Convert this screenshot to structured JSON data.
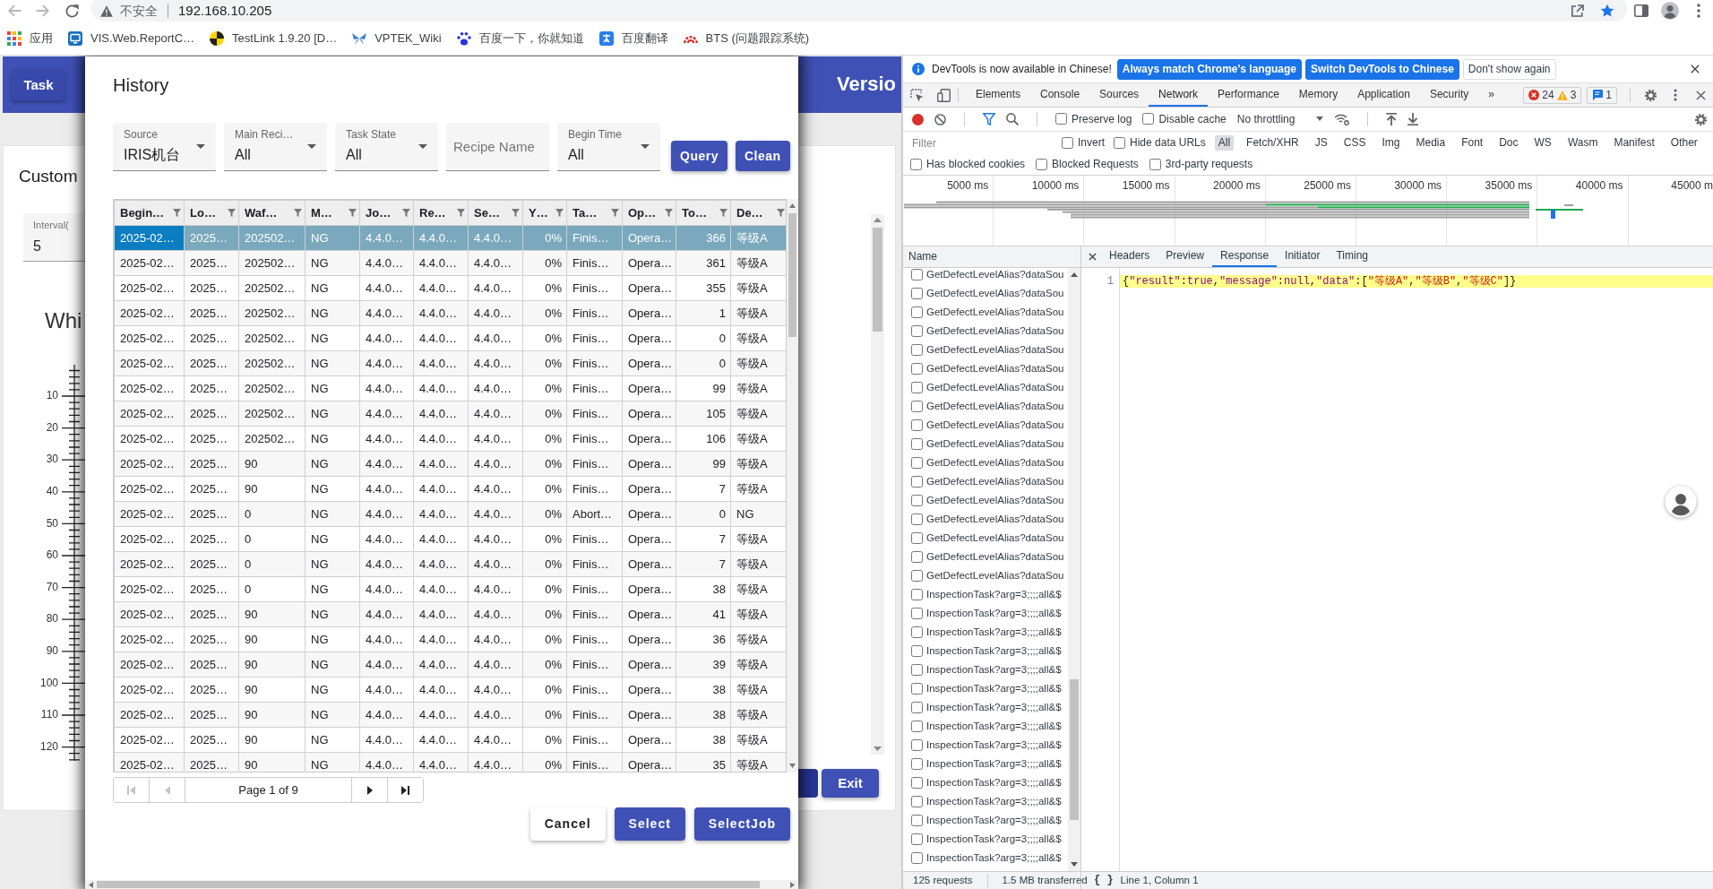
{
  "browser": {
    "address": {
      "security_label": "不安全",
      "url": "192.168.10.205",
      "bookmarked": true
    },
    "bookmarks": [
      {
        "label": "应用",
        "kind": "apps"
      },
      {
        "label": "VIS.Web.ReportC…",
        "kind": "monitor"
      },
      {
        "label": "TestLink 1.9.20 [D…",
        "kind": "testlink"
      },
      {
        "label": "VPTEK_Wiki",
        "kind": "wiki"
      },
      {
        "label": "百度一下，你就知道",
        "kind": "paw"
      },
      {
        "label": "百度翻译",
        "kind": "translate"
      },
      {
        "label": "BTS (问题跟踪系统)",
        "kind": "bts"
      }
    ]
  },
  "app_page": {
    "task_button": "Task",
    "version_title": "Versio",
    "card_title": "Custom",
    "interval": {
      "label": "Interval(",
      "value": "5"
    },
    "heading": "Whi",
    "ruler_labels": [
      "10",
      "20",
      "30",
      "40",
      "50",
      "60",
      "70",
      "80",
      "90",
      "100",
      "110",
      "120"
    ],
    "exit_button": "Exit"
  },
  "history_dialog": {
    "title": "History",
    "filters": [
      {
        "kind": "select",
        "label": "Source",
        "value": "IRIS机台"
      },
      {
        "kind": "select",
        "label": "Main Reci…",
        "value": "All"
      },
      {
        "kind": "select",
        "label": "Task State",
        "value": "All"
      },
      {
        "kind": "text",
        "placeholder": "Recipe Name"
      },
      {
        "kind": "select",
        "label": "Begin Time",
        "value": "All"
      }
    ],
    "actions": [
      "Query",
      "Clean"
    ],
    "table": {
      "columns": [
        {
          "label": "Begin…",
          "kind": "text"
        },
        {
          "label": "Lo…",
          "kind": "text"
        },
        {
          "label": "Waf…",
          "kind": "text"
        },
        {
          "label": "M…",
          "kind": "text"
        },
        {
          "label": "Jo…",
          "kind": "text"
        },
        {
          "label": "Re…",
          "kind": "text"
        },
        {
          "label": "Se…",
          "kind": "text"
        },
        {
          "label": "Y…",
          "kind": "number"
        },
        {
          "label": "Ta…",
          "kind": "text"
        },
        {
          "label": "Op…",
          "kind": "text"
        },
        {
          "label": "To…",
          "kind": "number"
        },
        {
          "label": "De…",
          "kind": "text"
        }
      ],
      "rows": [
        {
          "selected": true,
          "focused": true,
          "cells": [
            "2025-02…",
            "2025…",
            "202502…",
            "NG",
            "4.4.0…",
            "4.4.0…",
            "4.4.0…",
            "0%",
            "Finis…",
            "Opera…",
            "366",
            "等级A"
          ]
        },
        {
          "selected": false,
          "focused": false,
          "cells": [
            "2025-02…",
            "2025…",
            "202502…",
            "NG",
            "4.4.0…",
            "4.4.0…",
            "4.4.0…",
            "0%",
            "Finis…",
            "Opera…",
            "361",
            "等级A"
          ]
        },
        {
          "selected": false,
          "focused": false,
          "cells": [
            "2025-02…",
            "2025…",
            "202502…",
            "NG",
            "4.4.0…",
            "4.4.0…",
            "4.4.0…",
            "0%",
            "Finis…",
            "Opera…",
            "355",
            "等级A"
          ]
        },
        {
          "selected": false,
          "focused": false,
          "cells": [
            "2025-02…",
            "2025…",
            "202502…",
            "NG",
            "4.4.0…",
            "4.4.0…",
            "4.4.0…",
            "0%",
            "Finis…",
            "Opera…",
            "1",
            "等级A"
          ]
        },
        {
          "selected": false,
          "focused": false,
          "cells": [
            "2025-02…",
            "2025…",
            "202502…",
            "NG",
            "4.4.0…",
            "4.4.0…",
            "4.4.0…",
            "0%",
            "Finis…",
            "Opera…",
            "0",
            "等级A"
          ]
        },
        {
          "selected": false,
          "focused": false,
          "cells": [
            "2025-02…",
            "2025…",
            "202502…",
            "NG",
            "4.4.0…",
            "4.4.0…",
            "4.4.0…",
            "0%",
            "Finis…",
            "Opera…",
            "0",
            "等级A"
          ]
        },
        {
          "selected": false,
          "focused": false,
          "cells": [
            "2025-02…",
            "2025…",
            "202502…",
            "NG",
            "4.4.0…",
            "4.4.0…",
            "4.4.0…",
            "0%",
            "Finis…",
            "Opera…",
            "99",
            "等级A"
          ]
        },
        {
          "selected": false,
          "focused": false,
          "cells": [
            "2025-02…",
            "2025…",
            "202502…",
            "NG",
            "4.4.0…",
            "4.4.0…",
            "4.4.0…",
            "0%",
            "Finis…",
            "Opera…",
            "105",
            "等级A"
          ]
        },
        {
          "selected": false,
          "focused": false,
          "cells": [
            "2025-02…",
            "2025…",
            "202502…",
            "NG",
            "4.4.0…",
            "4.4.0…",
            "4.4.0…",
            "0%",
            "Finis…",
            "Opera…",
            "106",
            "等级A"
          ]
        },
        {
          "selected": false,
          "focused": false,
          "cells": [
            "2025-02…",
            "2025…",
            "90",
            "NG",
            "4.4.0…",
            "4.4.0…",
            "4.4.0…",
            "0%",
            "Finis…",
            "Opera…",
            "99",
            "等级A"
          ]
        },
        {
          "selected": false,
          "focused": false,
          "cells": [
            "2025-02…",
            "2025…",
            "90",
            "NG",
            "4.4.0…",
            "4.4.0…",
            "4.4.0…",
            "0%",
            "Finis…",
            "Opera…",
            "7",
            "等级A"
          ]
        },
        {
          "selected": false,
          "focused": false,
          "cells": [
            "2025-02…",
            "2025…",
            "0",
            "NG",
            "4.4.0…",
            "4.4.0…",
            "4.4.0…",
            "0%",
            "Abort…",
            "Opera…",
            "0",
            "NG"
          ]
        },
        {
          "selected": false,
          "focused": false,
          "cells": [
            "2025-02…",
            "2025…",
            "0",
            "NG",
            "4.4.0…",
            "4.4.0…",
            "4.4.0…",
            "0%",
            "Finis…",
            "Opera…",
            "7",
            "等级A"
          ]
        },
        {
          "selected": false,
          "focused": false,
          "cells": [
            "2025-02…",
            "2025…",
            "0",
            "NG",
            "4.4.0…",
            "4.4.0…",
            "4.4.0…",
            "0%",
            "Finis…",
            "Opera…",
            "7",
            "等级A"
          ]
        },
        {
          "selected": false,
          "focused": false,
          "cells": [
            "2025-02…",
            "2025…",
            "0",
            "NG",
            "4.4.0…",
            "4.4.0…",
            "4.4.0…",
            "0%",
            "Finis…",
            "Opera…",
            "38",
            "等级A"
          ]
        },
        {
          "selected": false,
          "focused": false,
          "cells": [
            "2025-02…",
            "2025…",
            "90",
            "NG",
            "4.4.0…",
            "4.4.0…",
            "4.4.0…",
            "0%",
            "Finis…",
            "Opera…",
            "41",
            "等级A"
          ]
        },
        {
          "selected": false,
          "focused": false,
          "cells": [
            "2025-02…",
            "2025…",
            "90",
            "NG",
            "4.4.0…",
            "4.4.0…",
            "4.4.0…",
            "0%",
            "Finis…",
            "Opera…",
            "36",
            "等级A"
          ]
        },
        {
          "selected": false,
          "focused": false,
          "cells": [
            "2025-02…",
            "2025…",
            "90",
            "NG",
            "4.4.0…",
            "4.4.0…",
            "4.4.0…",
            "0%",
            "Finis…",
            "Opera…",
            "39",
            "等级A"
          ]
        },
        {
          "selected": false,
          "focused": false,
          "cells": [
            "2025-02…",
            "2025…",
            "90",
            "NG",
            "4.4.0…",
            "4.4.0…",
            "4.4.0…",
            "0%",
            "Finis…",
            "Opera…",
            "38",
            "等级A"
          ]
        },
        {
          "selected": false,
          "focused": false,
          "cells": [
            "2025-02…",
            "2025…",
            "90",
            "NG",
            "4.4.0…",
            "4.4.0…",
            "4.4.0…",
            "0%",
            "Finis…",
            "Opera…",
            "38",
            "等级A"
          ]
        },
        {
          "selected": false,
          "focused": false,
          "cells": [
            "2025-02…",
            "2025…",
            "90",
            "NG",
            "4.4.0…",
            "4.4.0…",
            "4.4.0…",
            "0%",
            "Finis…",
            "Opera…",
            "38",
            "等级A"
          ]
        },
        {
          "selected": false,
          "focused": false,
          "cells": [
            "2025-02…",
            "2025…",
            "90",
            "NG",
            "4.4.0…",
            "4.4.0…",
            "4.4.0…",
            "0%",
            "Finis…",
            "Opera…",
            "35",
            "等级A"
          ]
        }
      ]
    },
    "pagination": {
      "label": "Page 1 of 9",
      "buttons": [
        {
          "kind": "first",
          "disabled": true
        },
        {
          "kind": "prev",
          "disabled": true
        },
        {
          "kind": "next",
          "disabled": false
        },
        {
          "kind": "last",
          "disabled": false
        }
      ]
    },
    "buttons": [
      {
        "label": "Cancel",
        "kind": "secondary"
      },
      {
        "label": "Select",
        "kind": "primary"
      },
      {
        "label": "SelectJob",
        "kind": "primary"
      }
    ]
  },
  "devtools": {
    "infobar": {
      "message": "DevTools is now available in Chinese!",
      "buttons": [
        {
          "label": "Always match Chrome's language",
          "kind": "primary"
        },
        {
          "label": "Switch DevTools to Chinese",
          "kind": "primary"
        },
        {
          "label": "Don't show again",
          "kind": "plain"
        }
      ]
    },
    "tabs": [
      {
        "label": "Elements",
        "selected": false
      },
      {
        "label": "Console",
        "selected": false
      },
      {
        "label": "Sources",
        "selected": false
      },
      {
        "label": "Network",
        "selected": true
      },
      {
        "label": "Performance",
        "selected": false
      },
      {
        "label": "Memory",
        "selected": false
      },
      {
        "label": "Application",
        "selected": false
      },
      {
        "label": "Security",
        "selected": false
      }
    ],
    "more_tabs": "»",
    "error_count": "24",
    "warning_count": "3",
    "message_count": "1",
    "toolbar": {
      "recording": true,
      "options": [
        {
          "label": "Preserve log",
          "checked": false
        },
        {
          "label": "Disable cache",
          "checked": false
        }
      ],
      "throttling": "No throttling"
    },
    "filter": {
      "placeholder": "Filter",
      "options": [
        {
          "label": "Invert",
          "checked": false
        },
        {
          "label": "Hide data URLs",
          "checked": false
        }
      ],
      "types": [
        {
          "label": "All",
          "selected": true
        },
        {
          "label": "Fetch/XHR",
          "selected": false
        },
        {
          "label": "JS",
          "selected": false
        },
        {
          "label": "CSS",
          "selected": false
        },
        {
          "label": "Img",
          "selected": false
        },
        {
          "label": "Media",
          "selected": false
        },
        {
          "label": "Font",
          "selected": false
        },
        {
          "label": "Doc",
          "selected": false
        },
        {
          "label": "WS",
          "selected": false
        },
        {
          "label": "Wasm",
          "selected": false
        },
        {
          "label": "Manifest",
          "selected": false
        },
        {
          "label": "Other",
          "selected": false
        }
      ]
    },
    "more_options": [
      {
        "label": "Has blocked cookies",
        "checked": false
      },
      {
        "label": "Blocked Requests",
        "checked": false
      },
      {
        "label": "3rd-party requests",
        "checked": false
      }
    ],
    "overview_ticks": [
      "5000 ms",
      "10000 ms",
      "15000 ms",
      "20000 ms",
      "25000 ms",
      "30000 ms",
      "35000 ms",
      "40000 ms",
      "45000 m"
    ],
    "requests": {
      "header": "Name",
      "items": [
        {
          "name": "GetDefectLevelAlias?dataSou",
          "checked": false
        },
        {
          "name": "GetDefectLevelAlias?dataSou",
          "checked": false
        },
        {
          "name": "GetDefectLevelAlias?dataSou",
          "checked": false
        },
        {
          "name": "GetDefectLevelAlias?dataSou",
          "checked": false
        },
        {
          "name": "GetDefectLevelAlias?dataSou",
          "checked": false
        },
        {
          "name": "GetDefectLevelAlias?dataSou",
          "checked": false
        },
        {
          "name": "GetDefectLevelAlias?dataSou",
          "checked": false
        },
        {
          "name": "GetDefectLevelAlias?dataSou",
          "checked": false
        },
        {
          "name": "GetDefectLevelAlias?dataSou",
          "checked": false
        },
        {
          "name": "GetDefectLevelAlias?dataSou",
          "checked": false
        },
        {
          "name": "GetDefectLevelAlias?dataSou",
          "checked": false
        },
        {
          "name": "GetDefectLevelAlias?dataSou",
          "checked": false
        },
        {
          "name": "GetDefectLevelAlias?dataSou",
          "checked": false
        },
        {
          "name": "GetDefectLevelAlias?dataSou",
          "checked": false
        },
        {
          "name": "GetDefectLevelAlias?dataSou",
          "checked": false
        },
        {
          "name": "GetDefectLevelAlias?dataSou",
          "checked": false
        },
        {
          "name": "GetDefectLevelAlias?dataSou",
          "checked": false
        },
        {
          "name": "InspectionTask?arg=3;;;;all&$",
          "checked": false
        },
        {
          "name": "InspectionTask?arg=3;;;;all&$",
          "checked": false
        },
        {
          "name": "InspectionTask?arg=3;;;;all&$",
          "checked": false
        },
        {
          "name": "InspectionTask?arg=3;;;;all&$",
          "checked": false
        },
        {
          "name": "InspectionTask?arg=3;;;;all&$",
          "checked": false
        },
        {
          "name": "InspectionTask?arg=3;;;;all&$",
          "checked": false
        },
        {
          "name": "InspectionTask?arg=3;;;;all&$",
          "checked": false
        },
        {
          "name": "InspectionTask?arg=3;;;;all&$",
          "checked": false
        },
        {
          "name": "InspectionTask?arg=3;;;;all&$",
          "checked": false
        },
        {
          "name": "InspectionTask?arg=3;;;;all&$",
          "checked": false
        },
        {
          "name": "InspectionTask?arg=3;;;;all&$",
          "checked": false
        },
        {
          "name": "InspectionTask?arg=3;;;;all&$",
          "checked": false
        },
        {
          "name": "InspectionTask?arg=3;;;;all&$",
          "checked": false
        },
        {
          "name": "InspectionTask?arg=3;;;;all&$",
          "checked": false
        },
        {
          "name": "InspectionTask?arg=3;;;;all&$",
          "checked": false
        }
      ]
    },
    "detail_tabs": [
      {
        "label": "Headers",
        "selected": false
      },
      {
        "label": "Preview",
        "selected": false
      },
      {
        "label": "Response",
        "selected": true
      },
      {
        "label": "Initiator",
        "selected": false
      },
      {
        "label": "Timing",
        "selected": false
      }
    ],
    "response": {
      "line_number": "1",
      "tokens": [
        {
          "kind": "punct",
          "text": "{"
        },
        {
          "kind": "key",
          "text": "\"result\""
        },
        {
          "kind": "punct",
          "text": ":"
        },
        {
          "kind": "literal",
          "text": "true"
        },
        {
          "kind": "punct",
          "text": ","
        },
        {
          "kind": "key",
          "text": "\"message\""
        },
        {
          "kind": "punct",
          "text": ":"
        },
        {
          "kind": "literal",
          "text": "null"
        },
        {
          "kind": "punct",
          "text": ","
        },
        {
          "kind": "key",
          "text": "\"data\""
        },
        {
          "kind": "punct",
          "text": ":["
        },
        {
          "kind": "string",
          "text": "\"等级A\""
        },
        {
          "kind": "punct",
          "text": ","
        },
        {
          "kind": "string",
          "text": "\"等级B\""
        },
        {
          "kind": "punct",
          "text": ","
        },
        {
          "kind": "string",
          "text": "\"等级C\""
        },
        {
          "kind": "punct",
          "text": "]}"
        }
      ]
    },
    "status": {
      "requests": "125 requests",
      "transferred": "1.5 MB transferred",
      "format_button": "{ }",
      "cursor": "Line 1, Column 1"
    }
  }
}
